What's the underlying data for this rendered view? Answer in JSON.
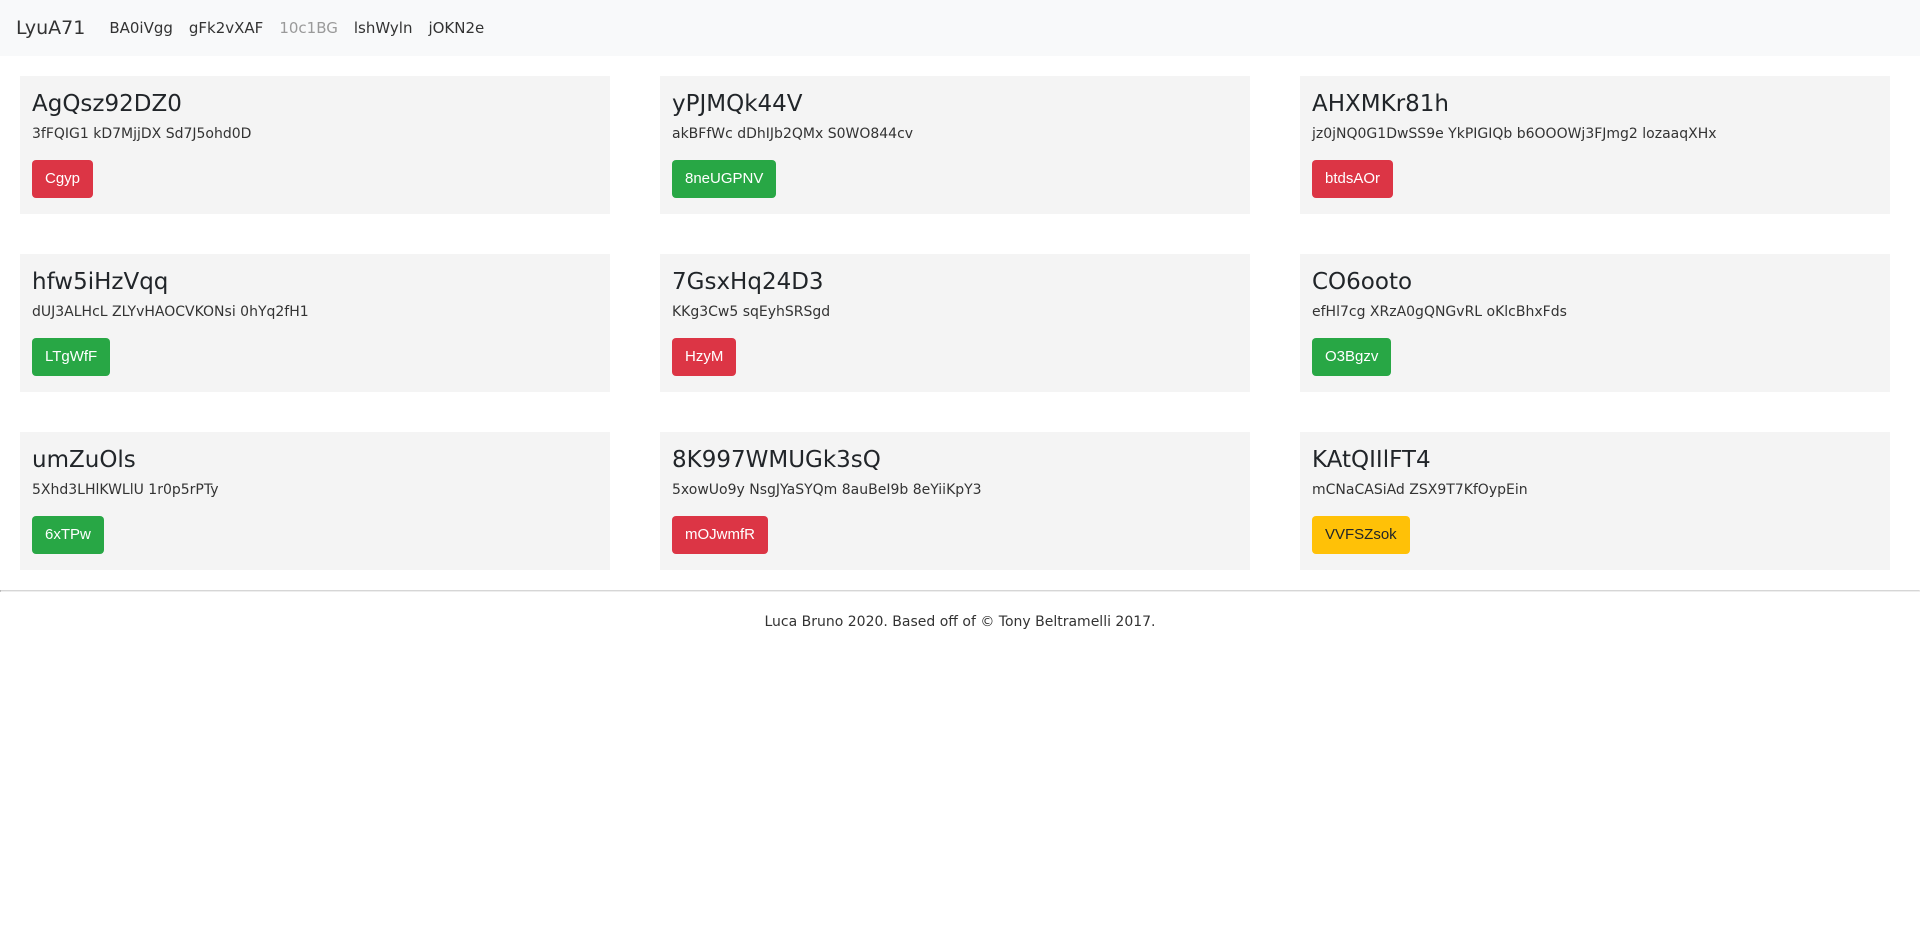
{
  "navbar": {
    "brand": "LyuA71",
    "links": [
      "BA0iVgg",
      "gFk2vXAF",
      "10c1BG",
      "lshWyln",
      "jOKN2e"
    ]
  },
  "cards": [
    {
      "title": "AgQsz92DZ0",
      "text": "3fFQIG1 kD7MjjDX Sd7J5ohd0D",
      "button": "Cgyp",
      "button_color": "#dc3545"
    },
    {
      "title": "yPJMQk44V",
      "text": "akBFfWc dDhIJb2QMx S0WO844cv",
      "button": "8neUGPNV",
      "button_color": "#28a745"
    },
    {
      "title": "AHXMKr81h",
      "text": "jz0jNQ0G1DwSS9e YkPIGIQb b6OOOWj3FJmg2 lozaaqXHx",
      "button": "btdsAOr",
      "button_color": "#dc3545"
    },
    {
      "title": "hfw5iHzVqq",
      "text": "dUJ3ALHcL ZLYvHAOCVKONsi 0hYq2fH1",
      "button": "LTgWfF",
      "button_color": "#28a745"
    },
    {
      "title": "7GsxHq24D3",
      "text": "KKg3Cw5 sqEyhSRSgd",
      "button": "HzyM",
      "button_color": "#dc3545"
    },
    {
      "title": "CO6ooto",
      "text": "efHl7cg XRzA0gQNGvRL oKlcBhxFds",
      "button": "O3Bgzv",
      "button_color": "#28a745"
    },
    {
      "title": "umZuOls",
      "text": "5Xhd3LHlKWLlU 1r0p5rPTy",
      "button": "6xTPw",
      "button_color": "#28a745"
    },
    {
      "title": "8K997WMUGk3sQ",
      "text": "5xowUo9y NsgJYaSYQm 8auBeI9b 8eYiiKpY3",
      "button": "mOJwmfR",
      "button_color": "#dc3545"
    },
    {
      "title": "KAtQIIlFT4",
      "text": "mCNaCASiAd ZSX9T7KfOypEin",
      "button": "VVFSZsok",
      "button_color": "#ffc107"
    }
  ],
  "footer": {
    "text": "Luca Bruno 2020. Based off of © Tony Beltramelli 2017."
  }
}
